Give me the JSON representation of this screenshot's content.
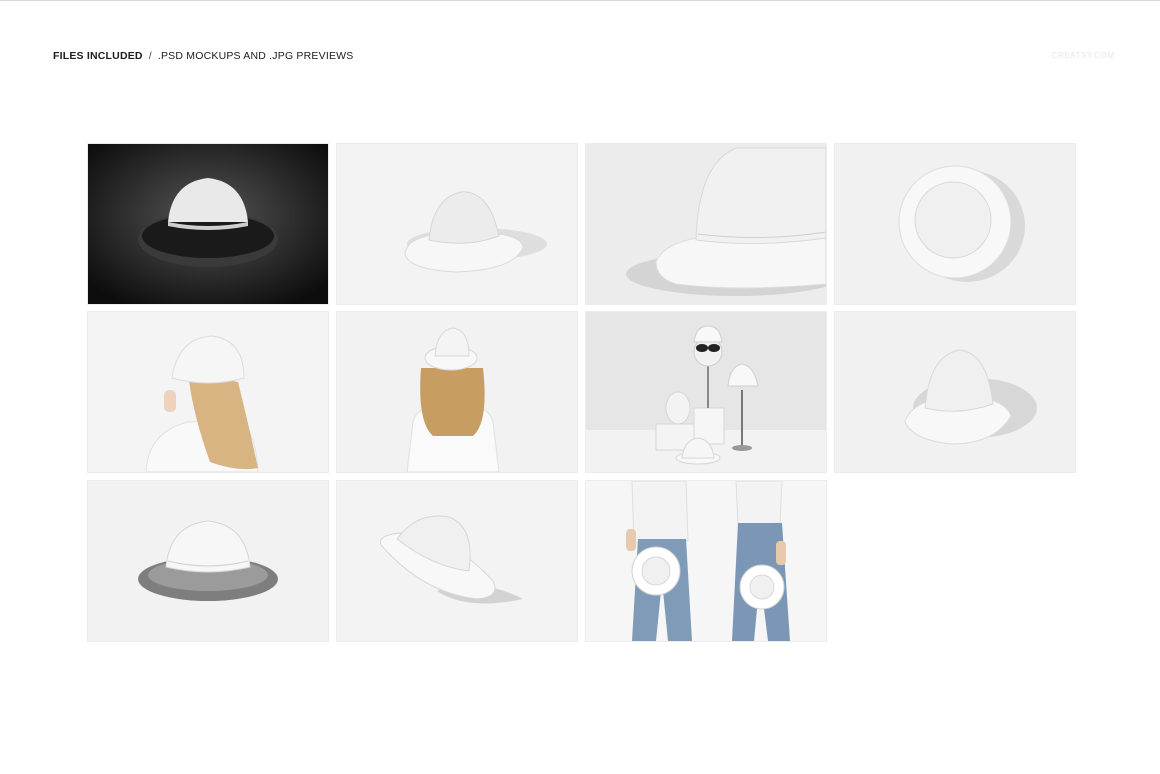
{
  "header": {
    "title": "FILES INCLUDED",
    "separator": "/",
    "subtitle": ".PSD MOCKUPS AND .JPG PREVIEWS",
    "watermark": "CREATSY.COM"
  },
  "previews": [
    {
      "subject": "hat-front-dark",
      "background": "#111111"
    },
    {
      "subject": "hat-side-light",
      "background": "#f3f3f3"
    },
    {
      "subject": "hat-closeup",
      "background": "#ececec"
    },
    {
      "subject": "hat-top-view",
      "background": "#f1f1f1"
    },
    {
      "subject": "woman-side",
      "background": "#f4f4f4"
    },
    {
      "subject": "woman-back",
      "background": "#f2f2f2"
    },
    {
      "subject": "stands-scene",
      "background": "#e6e6e6"
    },
    {
      "subject": "hat-angled",
      "background": "#f1f1f1"
    },
    {
      "subject": "hat-underside",
      "background": "#f2f2f2"
    },
    {
      "subject": "hat-floating",
      "background": "#f3f3f3"
    },
    {
      "subject": "two-people-holding-hats",
      "background": "#f6f6f6"
    }
  ]
}
